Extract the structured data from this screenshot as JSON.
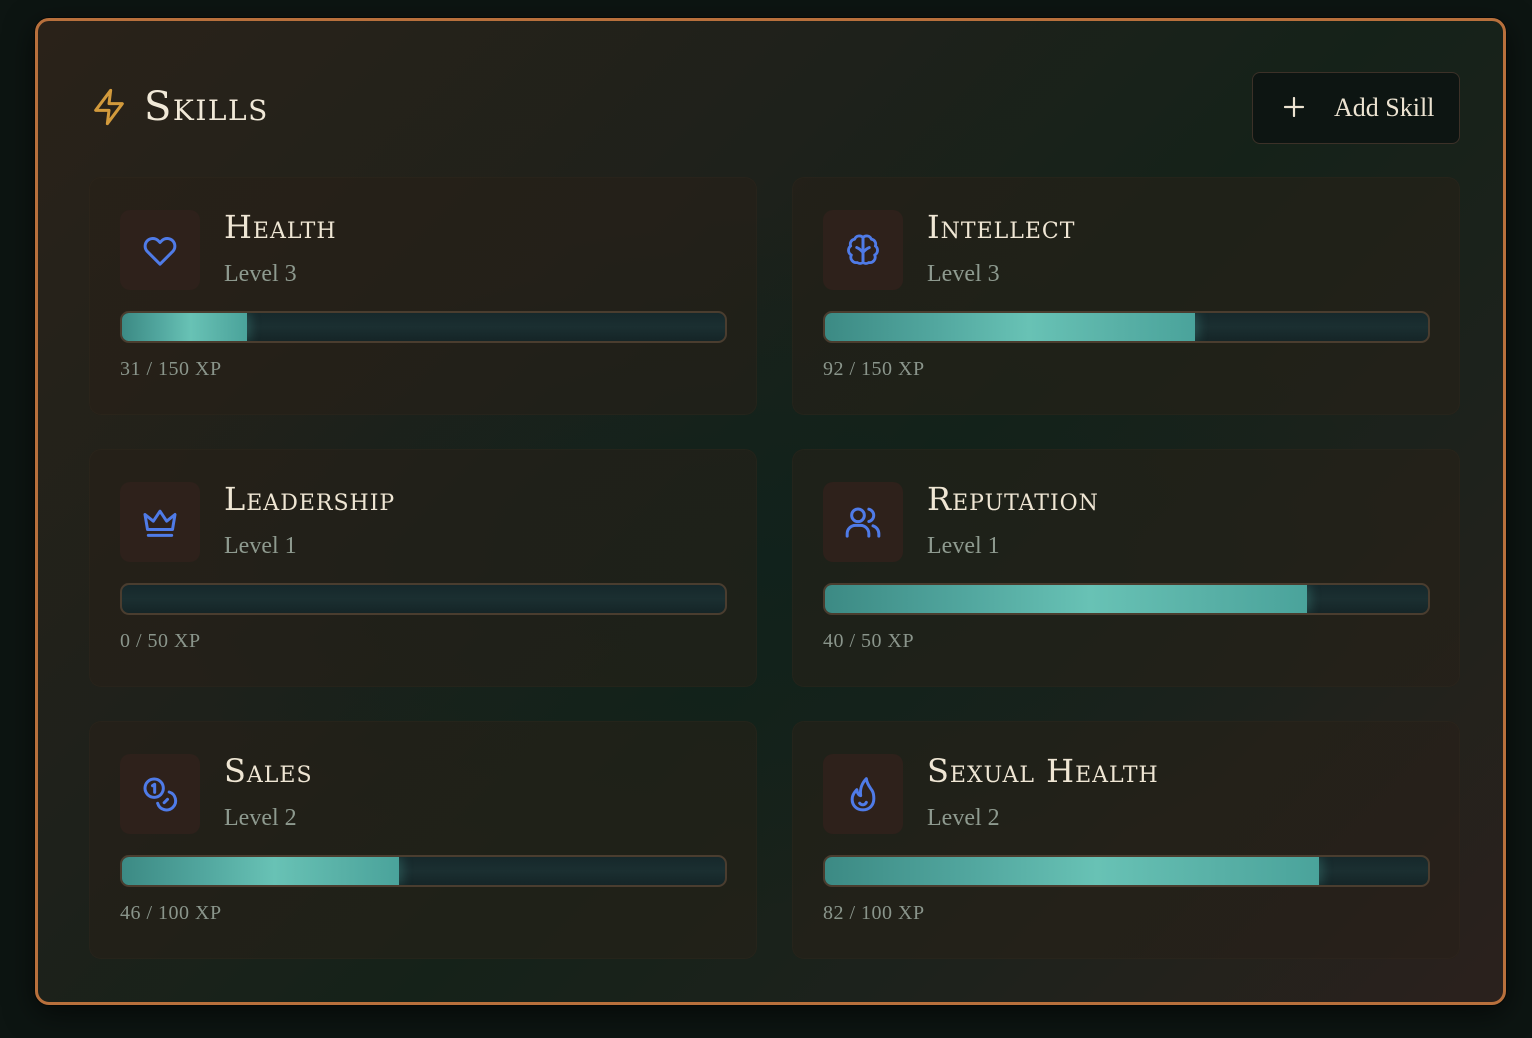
{
  "header": {
    "title": "Skills",
    "icon": "lightning-bolt-icon",
    "add_button_label": "Add Skill"
  },
  "colors": {
    "panel_border": "#b8703c",
    "title_icon": "#d29a3c",
    "skill_icon": "#4f7be8",
    "bar_fill": "#5fb8ad"
  },
  "skills": [
    {
      "name": "Health",
      "level": "Level 3",
      "xp": "31 / 150 XP",
      "progress": 0.207,
      "icon": "heart-icon"
    },
    {
      "name": "Intellect",
      "level": "Level 3",
      "xp": "92 / 150 XP",
      "progress": 0.613,
      "icon": "brain-icon"
    },
    {
      "name": "Leadership",
      "level": "Level 1",
      "xp": "0 / 50 XP",
      "progress": 0.0,
      "icon": "crown-icon"
    },
    {
      "name": "Reputation",
      "level": "Level 1",
      "xp": "40 / 50 XP",
      "progress": 0.8,
      "icon": "users-icon"
    },
    {
      "name": "Sales",
      "level": "Level 2",
      "xp": "46 / 100 XP",
      "progress": 0.46,
      "icon": "coins-icon"
    },
    {
      "name": "Sexual Health",
      "level": "Level 2",
      "xp": "82 / 100 XP",
      "progress": 0.82,
      "icon": "flame-icon"
    }
  ]
}
